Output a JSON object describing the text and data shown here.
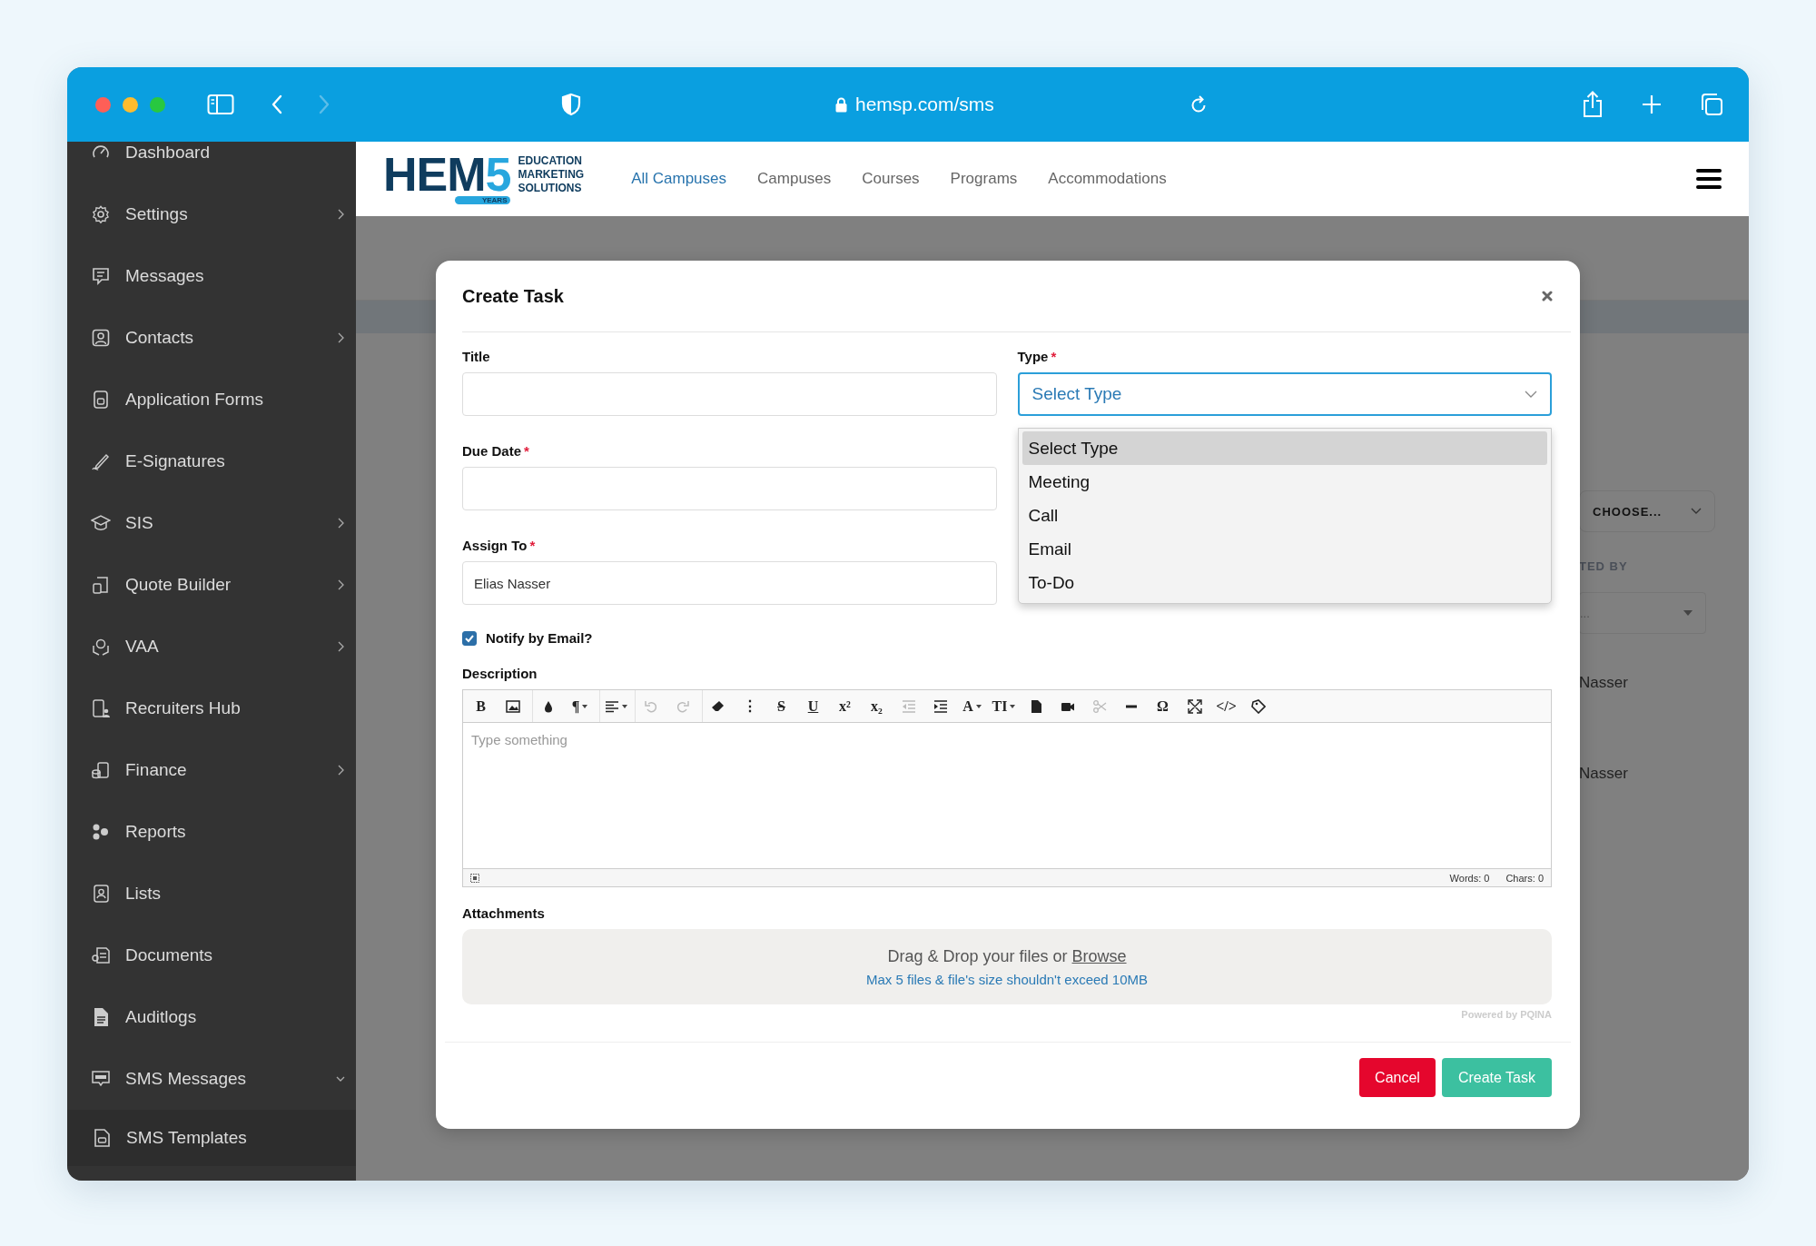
{
  "browser": {
    "address": "hemsp.com/sms",
    "forward_disabled": true
  },
  "sidebar": {
    "items": [
      {
        "label": "Dashboard",
        "submenu": false
      },
      {
        "label": "Settings",
        "submenu": true,
        "expanded": false
      },
      {
        "label": "Messages",
        "submenu": false
      },
      {
        "label": "Contacts",
        "submenu": true,
        "expanded": false
      },
      {
        "label": "Application Forms",
        "submenu": false
      },
      {
        "label": "E-Signatures",
        "submenu": false
      },
      {
        "label": "SIS",
        "submenu": true,
        "expanded": false
      },
      {
        "label": "Quote Builder",
        "submenu": true,
        "expanded": false
      },
      {
        "label": "VAA",
        "submenu": true,
        "expanded": false
      },
      {
        "label": "Recruiters Hub",
        "submenu": false
      },
      {
        "label": "Finance",
        "submenu": true,
        "expanded": false
      },
      {
        "label": "Reports",
        "submenu": false
      },
      {
        "label": "Lists",
        "submenu": false
      },
      {
        "label": "Documents",
        "submenu": false
      },
      {
        "label": "Auditlogs",
        "submenu": false
      },
      {
        "label": "SMS Messages",
        "submenu": true,
        "expanded": true,
        "children": [
          {
            "label": "SMS Templates"
          }
        ]
      }
    ]
  },
  "header": {
    "logo": {
      "letters": "HEM",
      "number": "5",
      "tagline": [
        "EDUCATION",
        "MARKETING",
        "SOLUTIONS"
      ],
      "badge": "YEARS"
    },
    "nav": [
      {
        "label": "All Campuses",
        "selected": true
      },
      {
        "label": "Campuses",
        "selected": false
      },
      {
        "label": "Courses",
        "selected": false
      },
      {
        "label": "Programs",
        "selected": false
      },
      {
        "label": "Accommodations",
        "selected": false
      }
    ]
  },
  "background": {
    "select": "CHOOSE...",
    "column_heading": "TED BY",
    "filter": "...",
    "cells": [
      "Nasser",
      "Nasser"
    ]
  },
  "modal": {
    "title": "Create Task",
    "fields": [
      {
        "label": "Title",
        "kind": "text"
      },
      {
        "label": "Type",
        "mark": "*",
        "kind": "select",
        "value": "Select Type",
        "open": true,
        "options": [
          {
            "label": "Select Type",
            "selected": true
          },
          {
            "label": "Meeting",
            "selected": false
          },
          {
            "label": "Call",
            "selected": false
          },
          {
            "label": "Email",
            "selected": false
          },
          {
            "label": "To-Do",
            "selected": false
          }
        ]
      },
      {
        "label": "Due Date",
        "mark": "*",
        "kind": "text"
      },
      {
        "label": "Assign To",
        "mark": "*",
        "kind": "text",
        "value": "Elias Nasser"
      }
    ],
    "notify": {
      "label": "Notify by Email?",
      "checked": true
    },
    "description": {
      "label": "Description",
      "placeholder": "Type something",
      "words": "Words: 0",
      "chars": "Chars: 0",
      "toolbar": [
        {
          "kind": "glyph",
          "text": "B",
          "disabled": false,
          "group_start": false,
          "dropdown": false
        },
        {
          "kind": "icon",
          "disabled": false,
          "group_start": false,
          "dropdown": false
        },
        {
          "kind": "icon",
          "disabled": false,
          "group_start": true,
          "dropdown": false
        },
        {
          "kind": "glyph",
          "text": "¶",
          "disabled": false,
          "group_start": false,
          "dropdown": true
        },
        {
          "kind": "icon",
          "disabled": false,
          "group_start": true,
          "dropdown": true
        },
        {
          "kind": "icon",
          "disabled": true,
          "group_start": true,
          "dropdown": false
        },
        {
          "kind": "icon",
          "disabled": true,
          "group_start": false,
          "dropdown": false
        },
        {
          "kind": "icon",
          "disabled": false,
          "group_start": true,
          "dropdown": false
        },
        {
          "kind": "glyph",
          "text": "⋮",
          "disabled": false,
          "group_start": false,
          "dropdown": false
        },
        {
          "kind": "glyph",
          "text": "S",
          "disabled": false,
          "group_start": false,
          "dropdown": false
        },
        {
          "kind": "glyph",
          "text": "U",
          "disabled": false,
          "group_start": false,
          "dropdown": false
        },
        {
          "kind": "glyph",
          "text": "x²",
          "disabled": false,
          "group_start": false,
          "dropdown": false
        },
        {
          "kind": "glyph",
          "text": "x₂",
          "disabled": false,
          "group_start": false,
          "dropdown": false
        },
        {
          "kind": "icon",
          "disabled": true,
          "group_start": false,
          "dropdown": false
        },
        {
          "kind": "icon",
          "disabled": false,
          "group_start": false,
          "dropdown": false
        },
        {
          "kind": "glyph",
          "text": "A",
          "disabled": false,
          "group_start": false,
          "dropdown": true
        },
        {
          "kind": "glyph",
          "text": "TI",
          "disabled": false,
          "group_start": false,
          "dropdown": true
        },
        {
          "kind": "icon",
          "disabled": false,
          "group_start": false,
          "dropdown": false
        },
        {
          "kind": "icon",
          "disabled": false,
          "group_start": false,
          "dropdown": false
        },
        {
          "kind": "icon",
          "disabled": true,
          "group_start": false,
          "dropdown": false
        },
        {
          "kind": "icon",
          "disabled": false,
          "group_start": false,
          "dropdown": false
        },
        {
          "kind": "glyph",
          "text": "Ω",
          "disabled": false,
          "group_start": false,
          "dropdown": false
        },
        {
          "kind": "icon",
          "disabled": false,
          "group_start": false,
          "dropdown": false
        },
        {
          "kind": "glyph",
          "text": "</>",
          "disabled": false,
          "group_start": false,
          "dropdown": false
        },
        {
          "kind": "icon",
          "disabled": false,
          "group_start": false,
          "dropdown": false
        }
      ]
    },
    "attachments": {
      "label": "Attachments",
      "prompt": "Drag & Drop your files or",
      "browse": "Browse",
      "limit": "Max 5 files & file's size shouldn't exceed 10MB",
      "credit": "Powered by PQINA"
    },
    "buttons": [
      {
        "label": "Cancel",
        "kind": "danger"
      },
      {
        "label": "Create Task",
        "kind": "primary"
      }
    ]
  }
}
